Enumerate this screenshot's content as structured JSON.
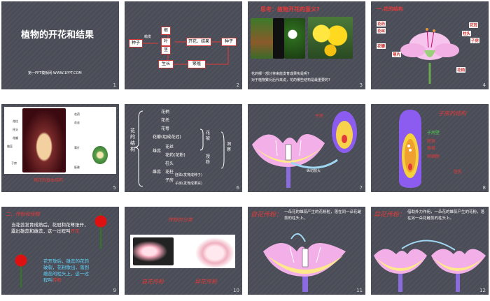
{
  "slides": [
    {
      "number": "1",
      "title": "植物的开花和结果",
      "subtitle": "第一PPT模板网-WWW.1PPT.COM"
    },
    {
      "number": "2",
      "flow": {
        "seed1": "种子",
        "sprout": "萌发",
        "root": "根",
        "stem": "茎",
        "leaf": "叶",
        "flower": "开花、结果",
        "seed2": "种子",
        "growth": "生长",
        "reproduce": "繁殖"
      }
    },
    {
      "number": "3",
      "heading": "思考：植物开花的意义?",
      "q1": "花的哪一部分将来能发育成果实是呢?",
      "q2": "对于植物繁衍后代来说，花的哪些结构是最重要的?"
    },
    {
      "number": "4",
      "heading": "一.花的结构",
      "labels": [
        "花药",
        "花丝",
        "花瓣",
        "萼片",
        "花冠",
        "柱头",
        "子房",
        "花柄"
      ]
    },
    {
      "number": "5",
      "caption": "桃花的基本结构",
      "labels": [
        "花柱",
        "柱头",
        "花瓣",
        "雄蕊",
        "子房",
        "花药",
        "花丝",
        "萼片",
        "胚珠"
      ]
    },
    {
      "number": "6",
      "root": "花的结构",
      "items": [
        "花柄",
        "花托",
        "花萼",
        "花瓣(组成花冠)",
        "雄蕊",
        "花丝",
        "花药(花粉)",
        "雌蕊",
        "柱头",
        "花柱",
        "子房",
        "胚珠(发育成种子)",
        "子房(发育成果实)"
      ],
      "groups": [
        "花被",
        "授粉",
        "洞察"
      ]
    },
    {
      "number": "7",
      "arrow_label": "纵切放大",
      "side": "子房"
    },
    {
      "number": "8",
      "heading": "子房的结构",
      "labels": [
        "子房壁",
        "胚珠",
        "珠被",
        "卵细胞",
        "胚乳"
      ]
    },
    {
      "number": "9",
      "heading": "二、传粉和受精",
      "p1": "当花蕊发育成熟后，花冠和花萼张开，露出雄蕊和雌蕊，这一过程叫",
      "p1_key": "开花",
      "p2": "花开放后，雄蕊的花药破裂，花粉散出，落到雌蕊的柱头上，这一过程叫",
      "p2_key": "传粉"
    },
    {
      "number": "10",
      "heading": "传粉的分类",
      "left_label": "自花传粉",
      "right_label": "异花传粉"
    },
    {
      "number": "11",
      "heading": "自花传粉：",
      "desc": "一朵花的雄蕊产生的花粉粒，落在同一朵花雌蕊的柱头上。"
    },
    {
      "number": "12",
      "heading": "异花传粉：",
      "desc": "借助外力作用，一朵花的雄蕊产生的花粉，落在另一朵花雌蕊的柱头上。"
    }
  ],
  "colors": {
    "slide_bg": "#4a4d57",
    "accent_red": "#e23a3a",
    "petal_pink": "#f0a8e8",
    "petal_yellow": "#ffe98a",
    "ovary_purple": "#8c5cf0"
  }
}
